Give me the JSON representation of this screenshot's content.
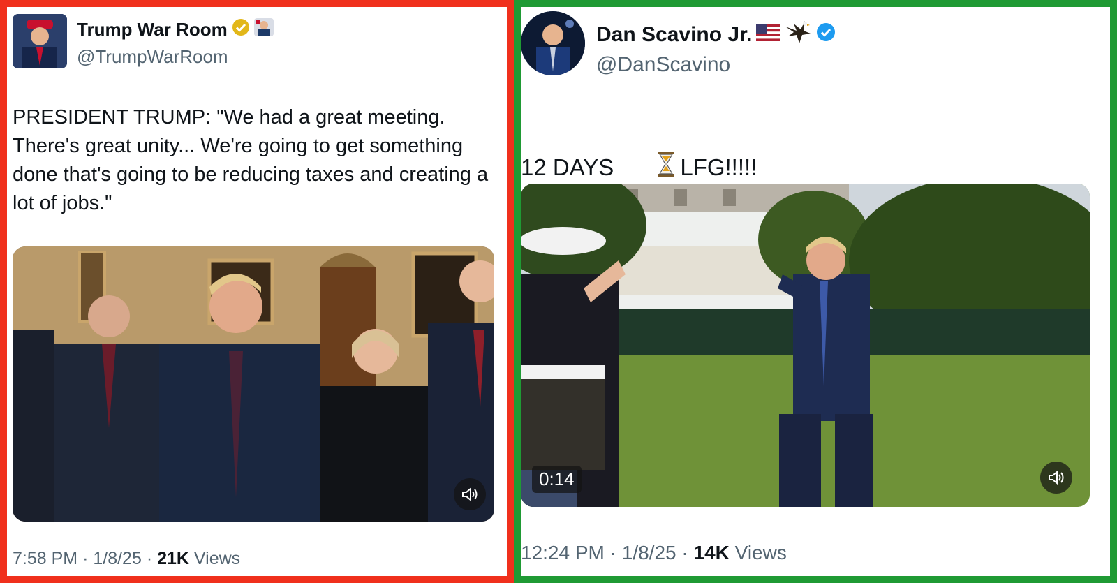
{
  "left_tweet": {
    "author_name": "Trump War Room",
    "handle": "@TrumpWarRoom",
    "text": "PRESIDENT TRUMP: \"We had a great meeting. There's great unity... We're going to get something done that's going to be reducing taxes and creating a lot of jobs.\"",
    "time": "7:58 PM",
    "date": "1/8/25",
    "views_count": "21K",
    "views_label": "Views",
    "separator": "·",
    "frame_color": "#f0301c",
    "verified_badge": "gold-check-icon"
  },
  "right_tweet": {
    "author_name": "Dan Scavino Jr.",
    "handle": "@DanScavino",
    "text_days": "12 DAYS",
    "text_tail": "LFG!!!!!",
    "video_timer": "0:14",
    "time": "12:24 PM",
    "date": "1/8/25",
    "views_count": "14K",
    "views_label": "Views",
    "separator": "·",
    "frame_color": "#1f9a34",
    "verified_badge": "blue-check-icon",
    "emoji_icons": [
      "us-flag-icon",
      "eagle-icon",
      "hourglass-icon"
    ]
  }
}
